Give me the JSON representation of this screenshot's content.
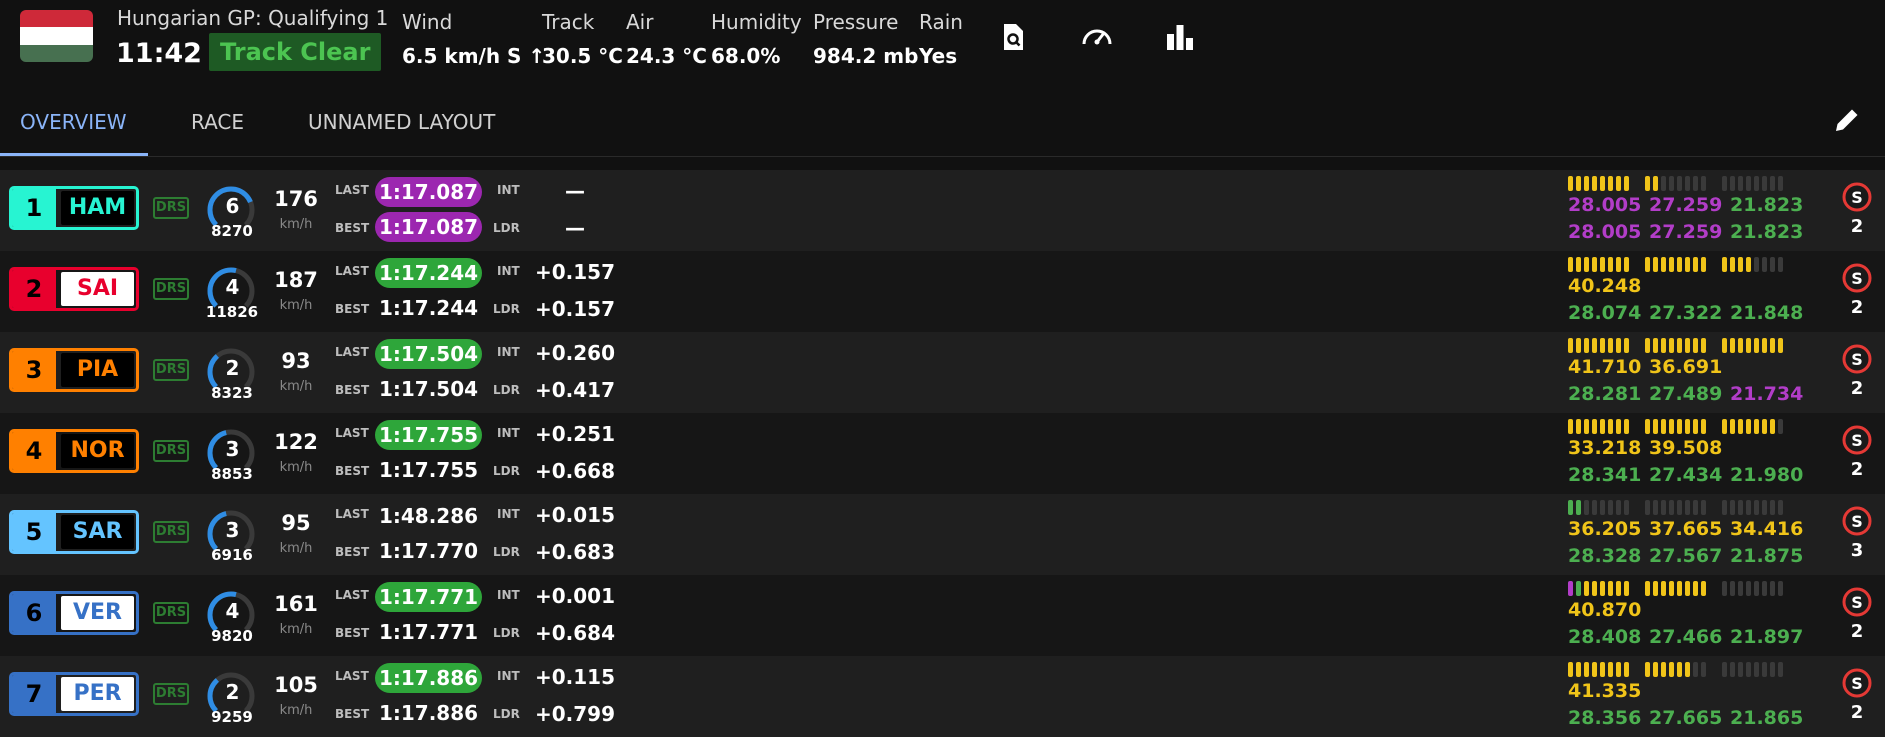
{
  "header": {
    "session": "Hungarian GP: Qualifying 1",
    "clock": "11:42",
    "track_status": "Track Clear",
    "weather": [
      {
        "label": "Wind",
        "value": "6.5 km/h S ↑"
      },
      {
        "label": "Track",
        "value": "30.5 °C"
      },
      {
        "label": "Air",
        "value": "24.3 °C"
      },
      {
        "label": "Humidity",
        "value": "68.0%"
      },
      {
        "label": "Pressure",
        "value": "984.2 mb"
      },
      {
        "label": "Rain",
        "value": "Yes"
      }
    ],
    "icons": [
      "page-search-icon",
      "speedometer-icon",
      "bar-chart-icon"
    ]
  },
  "tabs": [
    "OVERVIEW",
    "RACE",
    "UNNAMED LAYOUT"
  ],
  "active_tab": "OVERVIEW",
  "labels": {
    "drs": "DRS",
    "kmh": "km/h",
    "last": "LAST",
    "best": "BEST",
    "int": "INT",
    "ldr": "LDR"
  },
  "colors": {
    "purple": "#9c27b0",
    "green": "#2ea63a",
    "yellow": "#f0c419",
    "sector_green": "#4caf50",
    "sector_purple": "#b23dc8",
    "grey_segment": "#3a3a3a",
    "track_clear_bg": "#1e5a24",
    "accent_blue": "#8ab4f8"
  },
  "drivers": [
    {
      "pos": "1",
      "code": "HAM",
      "team_color": "#27f4d2",
      "code_bg": "#000000",
      "code_fg": "#27f4d2",
      "gear": "6",
      "gear_level": 0.75,
      "rpm": "8270",
      "speed": "176",
      "last": "1:17.087",
      "last_style": "purple",
      "best": "1:17.087",
      "best_style": "purple",
      "int": "—",
      "ldr": "—",
      "mini_y": 10,
      "mini_g": 0,
      "mini_p": 0,
      "s1": [
        "",
        "",
        ""
      ],
      "s1c": [
        "white",
        "white",
        "white"
      ],
      "s2": [
        "28.005",
        "27.259",
        "21.823"
      ],
      "s2c": [
        "purple",
        "purple",
        "green"
      ],
      "s1_prev": [
        "28.005",
        "27.259",
        "21.823"
      ],
      "s1_prevc": [
        "purple",
        "purple",
        "green"
      ],
      "tyre": "S",
      "stint": "2"
    },
    {
      "pos": "2",
      "code": "SAI",
      "team_color": "#e8002d",
      "code_bg": "#ffffff",
      "code_fg": "#e8002d",
      "gear": "4",
      "gear_level": 0.55,
      "rpm": "11826",
      "speed": "187",
      "last": "1:17.244",
      "last_style": "green",
      "best": "1:17.244",
      "best_style": "plain",
      "int": "+0.157",
      "ldr": "+0.157",
      "mini_y": 20,
      "mini_g": 0,
      "mini_p": 0,
      "s1": [
        "40.248",
        "",
        ""
      ],
      "s1c": [
        "yellow",
        "white",
        "white"
      ],
      "s2": [
        "28.074",
        "27.322",
        "21.848"
      ],
      "s2c": [
        "green",
        "green",
        "green"
      ],
      "tyre": "S",
      "stint": "2"
    },
    {
      "pos": "3",
      "code": "PIA",
      "team_color": "#ff8000",
      "code_bg": "#000000",
      "code_fg": "#ff8000",
      "gear": "2",
      "gear_level": 0.35,
      "rpm": "8323",
      "speed": "93",
      "last": "1:17.504",
      "last_style": "green",
      "best": "1:17.504",
      "best_style": "plain",
      "int": "+0.260",
      "ldr": "+0.417",
      "mini_y": 24,
      "mini_g": 0,
      "mini_p": 0,
      "s1": [
        "41.710",
        "36.691",
        ""
      ],
      "s1c": [
        "yellow",
        "yellow",
        "white"
      ],
      "s2": [
        "28.281",
        "27.489",
        "21.734"
      ],
      "s2c": [
        "green",
        "green",
        "purple"
      ],
      "tyre": "S",
      "stint": "2"
    },
    {
      "pos": "4",
      "code": "NOR",
      "team_color": "#ff8000",
      "code_bg": "#000000",
      "code_fg": "#ff8000",
      "gear": "3",
      "gear_level": 0.45,
      "rpm": "8853",
      "speed": "122",
      "last": "1:17.755",
      "last_style": "green",
      "best": "1:17.755",
      "best_style": "plain",
      "int": "+0.251",
      "ldr": "+0.668",
      "mini_y": 23,
      "mini_g": 0,
      "mini_p": 0,
      "s1": [
        "33.218",
        "39.508",
        ""
      ],
      "s1c": [
        "yellow",
        "yellow",
        "white"
      ],
      "s2": [
        "28.341",
        "27.434",
        "21.980"
      ],
      "s2c": [
        "green",
        "green",
        "green"
      ],
      "tyre": "S",
      "stint": "2"
    },
    {
      "pos": "5",
      "code": "SAR",
      "team_color": "#64c4ff",
      "code_bg": "#000000",
      "code_fg": "#64c4ff",
      "gear": "3",
      "gear_level": 0.45,
      "rpm": "6916",
      "speed": "95",
      "last": "1:48.286",
      "last_style": "plain",
      "best": "1:17.770",
      "best_style": "plain",
      "int": "+0.015",
      "ldr": "+0.683",
      "mini_y": 0,
      "mini_g": 2,
      "mini_p": 0,
      "s1": [
        "36.205",
        "37.665",
        "34.416"
      ],
      "s1c": [
        "yellow",
        "yellow",
        "yellow"
      ],
      "s2": [
        "28.328",
        "27.567",
        "21.875"
      ],
      "s2c": [
        "green",
        "green",
        "green"
      ],
      "tyre": "S",
      "stint": "3"
    },
    {
      "pos": "6",
      "code": "VER",
      "team_color": "#3671c6",
      "code_bg": "#ffffff",
      "code_fg": "#3671c6",
      "gear": "4",
      "gear_level": 0.55,
      "rpm": "9820",
      "speed": "161",
      "last": "1:17.771",
      "last_style": "green",
      "best": "1:17.771",
      "best_style": "plain",
      "int": "+0.001",
      "ldr": "+0.684",
      "mini_y": 14,
      "mini_g": 1,
      "mini_p": 1,
      "s1": [
        "40.870",
        "",
        ""
      ],
      "s1c": [
        "yellow",
        "white",
        "white"
      ],
      "s2": [
        "28.408",
        "27.466",
        "21.897"
      ],
      "s2c": [
        "green",
        "green",
        "green"
      ],
      "tyre": "S",
      "stint": "2"
    },
    {
      "pos": "7",
      "code": "PER",
      "team_color": "#3671c6",
      "code_bg": "#ffffff",
      "code_fg": "#3671c6",
      "gear": "2",
      "gear_level": 0.35,
      "rpm": "9259",
      "speed": "105",
      "last": "1:17.886",
      "last_style": "green",
      "best": "1:17.886",
      "best_style": "plain",
      "int": "+0.115",
      "ldr": "+0.799",
      "mini_y": 14,
      "mini_g": 0,
      "mini_p": 0,
      "s1": [
        "41.335",
        "",
        ""
      ],
      "s1c": [
        "yellow",
        "white",
        "white"
      ],
      "s2": [
        "28.356",
        "27.665",
        "21.865"
      ],
      "s2c": [
        "green",
        "green",
        "green"
      ],
      "tyre": "S",
      "stint": "2"
    }
  ]
}
